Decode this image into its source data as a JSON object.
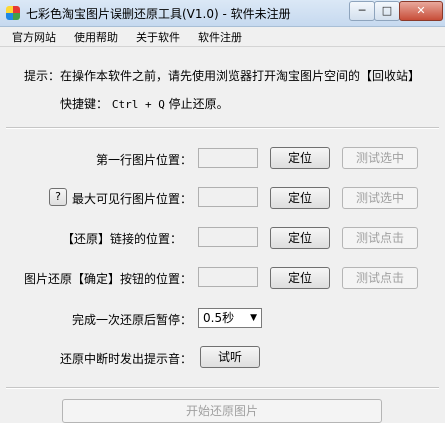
{
  "window": {
    "title": "七彩色淘宝图片误删还原工具(V1.0) - 软件未注册",
    "min_glyph": "─",
    "max_glyph": "□",
    "close_glyph": "✕"
  },
  "menu": [
    "官方网站",
    "使用帮助",
    "关于软件",
    "软件注册"
  ],
  "info": {
    "hint": "提示：在操作本软件之前，请先使用浏览器打开淘宝图片空间的【回收站】",
    "shortcut_label": "快捷键：",
    "shortcut_keys": "Ctrl + Q",
    "shortcut_action": "停止还原。"
  },
  "rows": [
    {
      "label": "第一行图片位置：",
      "locate": "定位",
      "test": "测试选中",
      "help": ""
    },
    {
      "label": "最大可见行图片位置：",
      "locate": "定位",
      "test": "测试选中",
      "help": "?"
    },
    {
      "label": "【还原】链接的位置：",
      "locate": "定位",
      "test": "测试点击",
      "help": ""
    },
    {
      "label": "图片还原【确定】按钮的位置：",
      "locate": "定位",
      "test": "测试点击",
      "help": ""
    }
  ],
  "pause": {
    "label": "完成一次还原后暂停：",
    "value": "0.5秒"
  },
  "sound": {
    "label": "还原中断时发出提示音：",
    "button": "试听"
  },
  "start": {
    "button": "开始还原图片"
  }
}
